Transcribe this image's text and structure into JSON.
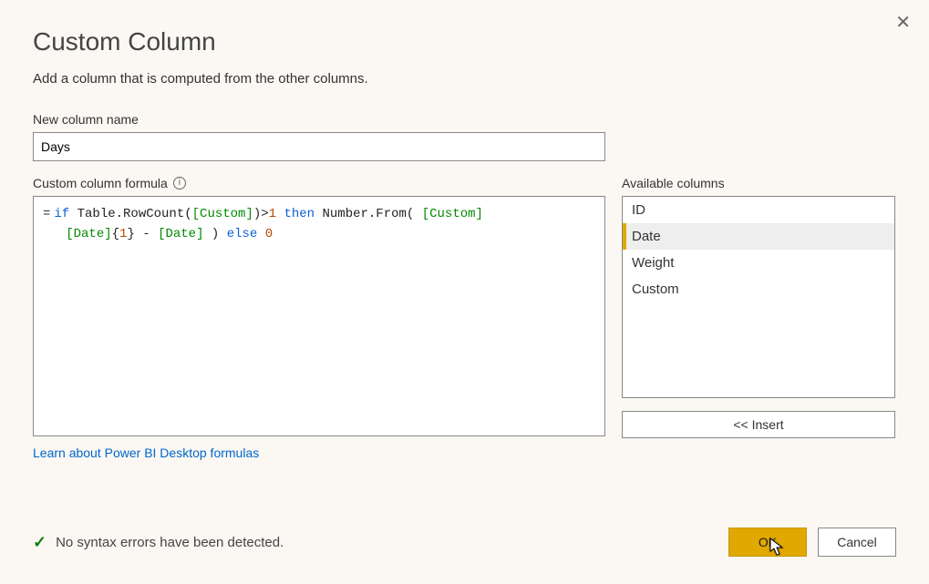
{
  "dialog": {
    "title": "Custom Column",
    "subtitle": "Add a column that is computed from the other columns.",
    "close_tooltip": "Close"
  },
  "name_field": {
    "label": "New column name",
    "value": "Days"
  },
  "formula": {
    "label": "Custom column formula",
    "eq": "=",
    "tokens": {
      "if": "if",
      "fn1": " Table.RowCount(",
      "col_custom1": "[Custom]",
      "gt": ")>",
      "n1": "1",
      "then": " then ",
      "fn2": "Number.From( ",
      "col_custom2": "[Custom]",
      "nl_indent": "\n   ",
      "col_date1": "[Date]",
      "brace_open": "{",
      "n_idx": "1",
      "brace_close": "} - ",
      "col_date2": "[Date]",
      "close_paren": " ) ",
      "else": "else ",
      "n0": "0"
    },
    "learn_link": "Learn about Power BI Desktop formulas"
  },
  "available": {
    "label": "Available columns",
    "items": [
      "ID",
      "Date",
      "Weight",
      "Custom"
    ],
    "selected_index": 1,
    "insert_label": "<< Insert"
  },
  "status": {
    "message": "No syntax errors have been detected."
  },
  "buttons": {
    "ok": "OK",
    "cancel": "Cancel"
  }
}
